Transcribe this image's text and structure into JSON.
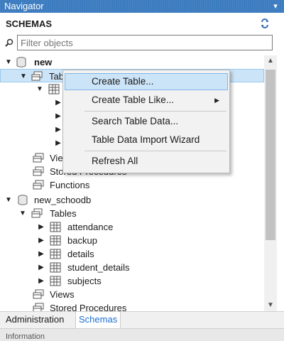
{
  "window": {
    "title": "Navigator"
  },
  "schemas": {
    "title": "SCHEMAS"
  },
  "filter": {
    "placeholder": "Filter objects"
  },
  "tree": {
    "schema1": {
      "name": "new",
      "tables_label": "Tables",
      "tables_visible": "Tab",
      "views": "Views",
      "views_visible": "View",
      "stored_procedures": "Stored Procedures",
      "functions": "Functions"
    },
    "schema2": {
      "name": "new_schoodb",
      "tables_label": "Tables",
      "tables": [
        "attendance",
        "backup",
        "details",
        "student_details",
        "subjects"
      ],
      "views": "Views",
      "stored_procedures": "Stored Procedures"
    }
  },
  "context_menu": {
    "items": [
      "Create Table...",
      "Create Table Like...",
      "Search Table Data...",
      "Table Data Import Wizard",
      "Refresh All"
    ]
  },
  "bottom_tabs": {
    "administration": "Administration",
    "schemas": "Schemas"
  },
  "info_bar": {
    "label": "Information"
  }
}
